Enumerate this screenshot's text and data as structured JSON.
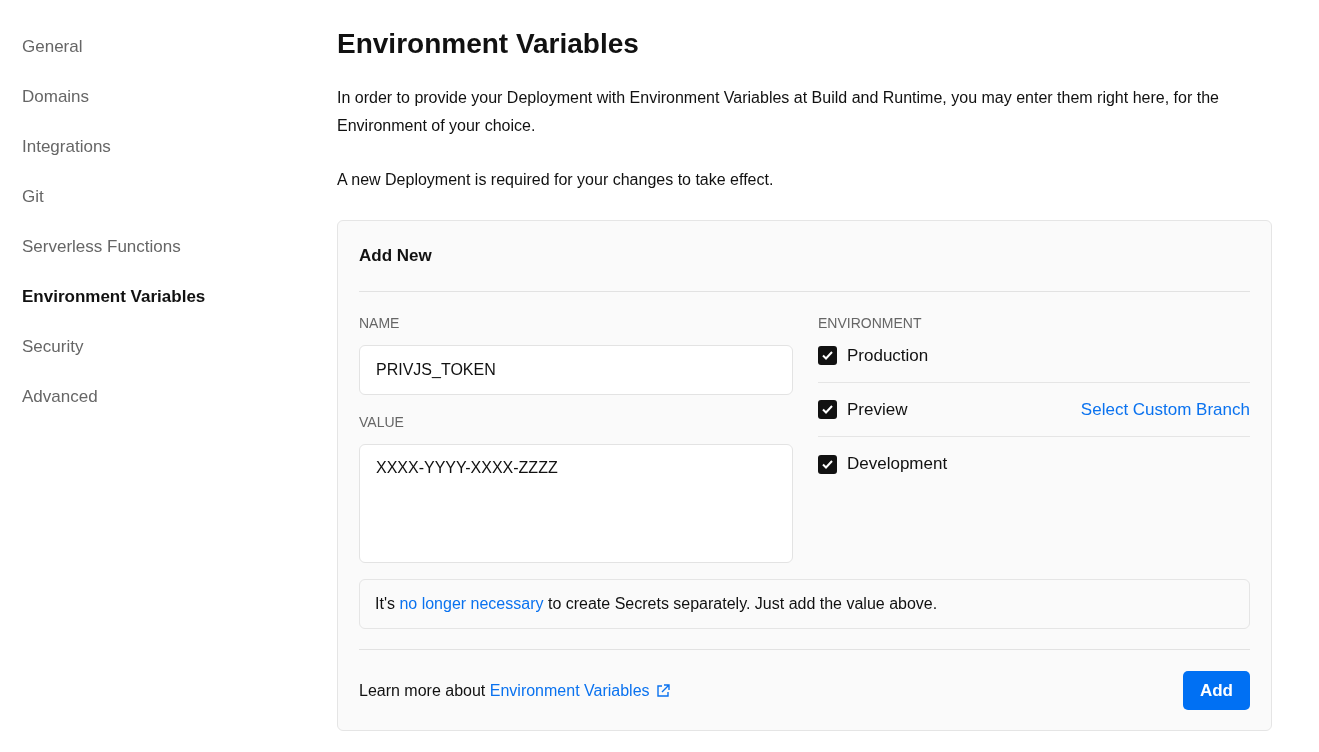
{
  "sidebar": {
    "items": [
      {
        "label": "General",
        "selected": false
      },
      {
        "label": "Domains",
        "selected": false
      },
      {
        "label": "Integrations",
        "selected": false
      },
      {
        "label": "Git",
        "selected": false
      },
      {
        "label": "Serverless Functions",
        "selected": false
      },
      {
        "label": "Environment Variables",
        "selected": true
      },
      {
        "label": "Security",
        "selected": false
      },
      {
        "label": "Advanced",
        "selected": false
      }
    ]
  },
  "title": "Environment Variables",
  "paragraphs": [
    "In order to provide your Deployment with Environment Variables at Build and Runtime, you may enter them right here, for the Environment of your choice.",
    "A new Deployment is required for your changes to take effect."
  ],
  "card": {
    "title": "Add New",
    "name_field": {
      "label": "NAME",
      "value": "PRIVJS_TOKEN"
    },
    "value_field": {
      "label": "VALUE",
      "value": "XXXX-YYYY-XXXX-ZZZZ"
    },
    "environment": {
      "label": "ENVIRONMENT",
      "options": [
        {
          "label": "Production",
          "checked": true
        },
        {
          "label": "Preview",
          "checked": true,
          "action": "Select Custom Branch"
        },
        {
          "label": "Development",
          "checked": true
        }
      ]
    },
    "notice": {
      "before": "It's ",
      "link": "no longer necessary",
      "after": " to create Secrets separately. Just add the value above."
    },
    "footer": {
      "text": "Learn more about ",
      "link": "Environment Variables",
      "button": "Add"
    }
  }
}
